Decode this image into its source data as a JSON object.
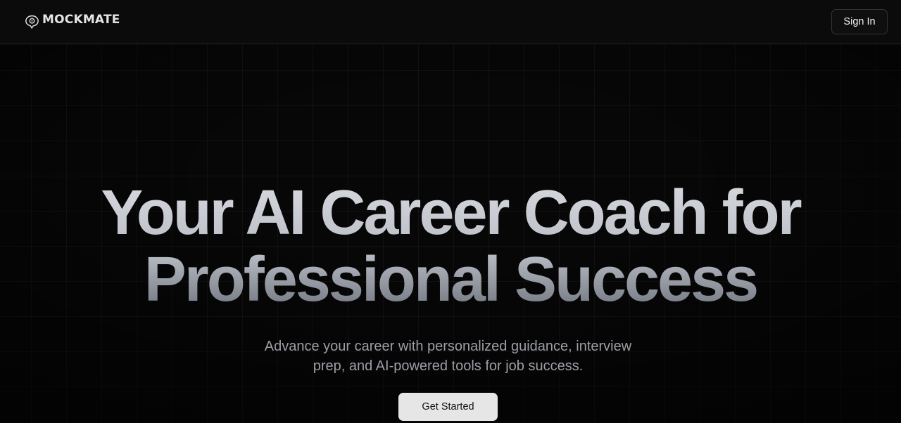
{
  "header": {
    "brand": "MOCKMATE",
    "brand_icon": "chat-bubble-icon",
    "signin_label": "Sign In"
  },
  "hero": {
    "headline_line1": "Your AI Career Coach for",
    "headline_line2": "Professional Success",
    "subtitle_line1": "Advance your career with personalized guidance, interview",
    "subtitle_line2": "prep, and AI-powered tools for job success.",
    "cta_label": "Get Started"
  },
  "colors": {
    "background": "#060606",
    "header_background": "#0b0b0b",
    "cta_background": "#e6e6e6",
    "subtitle_text": "#9c9fa6"
  }
}
